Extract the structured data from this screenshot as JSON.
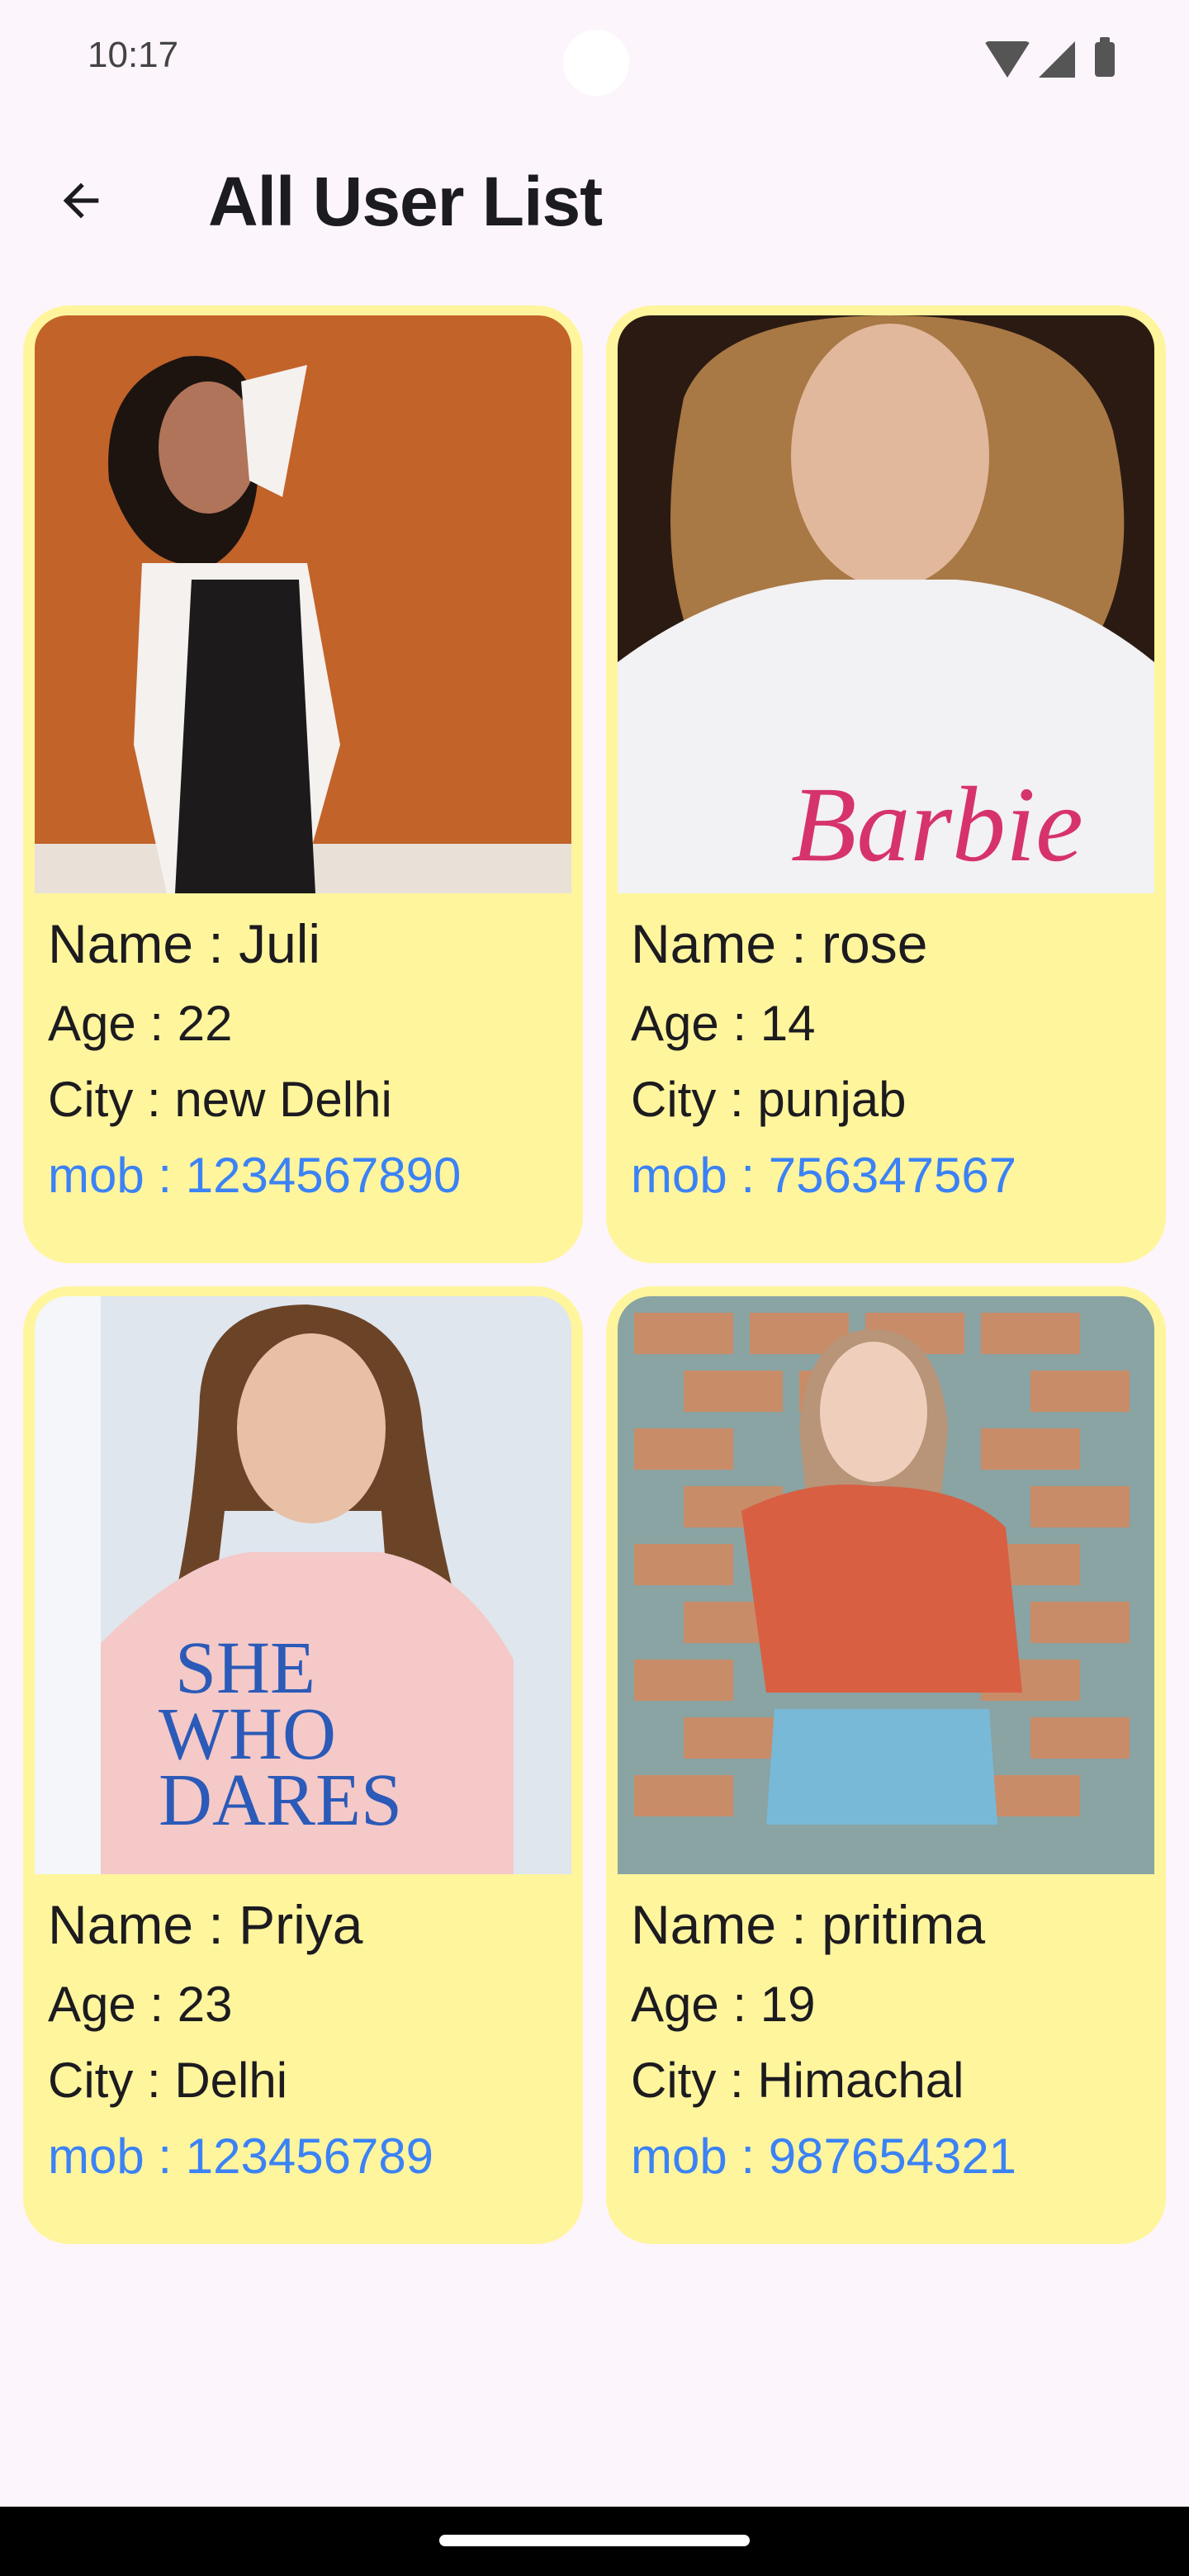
{
  "status_bar": {
    "time": "10:17",
    "icons": [
      "wifi-icon",
      "signal-icon",
      "battery-icon"
    ]
  },
  "app_bar": {
    "back_icon": "arrow-left-icon",
    "title": "All User List"
  },
  "colors": {
    "card": "#fff59d",
    "background": "#fdf5fc",
    "mobile_link": "#3b82f6"
  },
  "users": [
    {
      "name": "Name : Juli",
      "age": "Age : 22",
      "city": "City : new Delhi",
      "mob": "mob : 1234567890",
      "photo": "photo-juli"
    },
    {
      "name": "Name : rose",
      "age": "Age : 14",
      "city": "City : punjab",
      "mob": "mob : 756347567",
      "photo": "photo-rose"
    },
    {
      "name": "Name : Priya",
      "age": "Age : 23",
      "city": "City : Delhi",
      "mob": "mob : 123456789",
      "photo": "photo-priya"
    },
    {
      "name": "Name : pritima",
      "age": "Age : 19",
      "city": "City : Himachal",
      "mob": "mob : 987654321",
      "photo": "photo-pritima"
    }
  ]
}
